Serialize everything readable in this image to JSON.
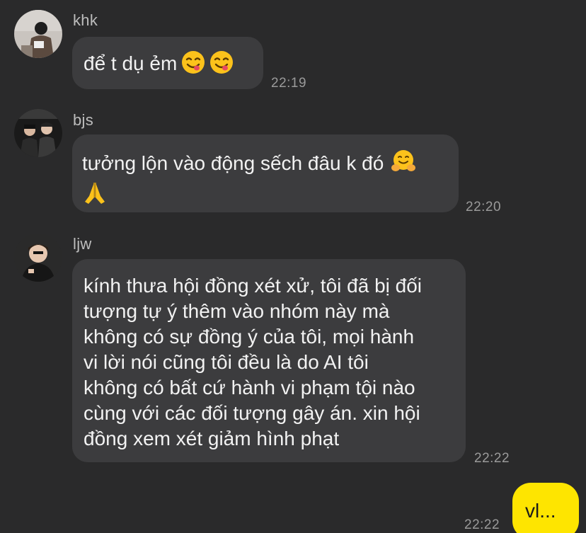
{
  "messages": [
    {
      "sender": "khk",
      "text": "để t dụ ẻm",
      "emojis": [
        "yum-face-icon",
        "yum-face-icon"
      ],
      "time": "22:19"
    },
    {
      "sender": "bjs",
      "text": "tưởng lộn vào động sếch đâu k đó",
      "emojis": [
        "hugging-face-icon",
        "folded-hands-icon"
      ],
      "time": "22:20"
    },
    {
      "sender": "ljw",
      "text": "kính thưa hội đồng xét xử, tôi đã bị đối\ntượng tự ý thêm vào nhóm này mà\nkhông có sự đồng ý của tôi, mọi hành\nvi lời nói cũng tôi đều là do AI tôi\nkhông có bất cứ hành vi phạm tội nào\ncùng với các đối tượng gây án. xin hội\nđồng xem xét giảm hình phạt",
      "time": "22:22"
    }
  ],
  "my_message": {
    "text": "vl...",
    "time": "22:22"
  },
  "colors": {
    "background": "#2a2a2b",
    "bubble": "#3c3c3e",
    "my_bubble": "#fee500"
  }
}
